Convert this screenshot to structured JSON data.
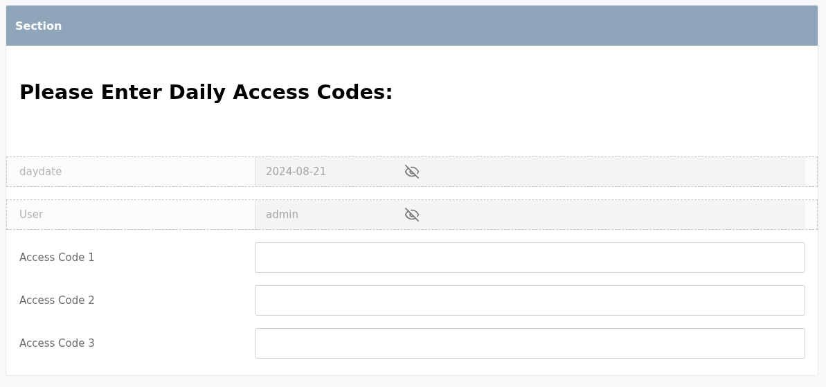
{
  "section": {
    "title": "Section"
  },
  "heading": "Please Enter Daily Access Codes:",
  "fields": [
    {
      "kind": "hidden",
      "label": "daydate",
      "value": "2024-08-21"
    },
    {
      "kind": "hidden",
      "label": "User",
      "value": "admin"
    },
    {
      "kind": "input",
      "label": "Access Code 1"
    },
    {
      "kind": "input",
      "label": "Access Code 2"
    },
    {
      "kind": "input",
      "label": "Access Code 3"
    }
  ]
}
